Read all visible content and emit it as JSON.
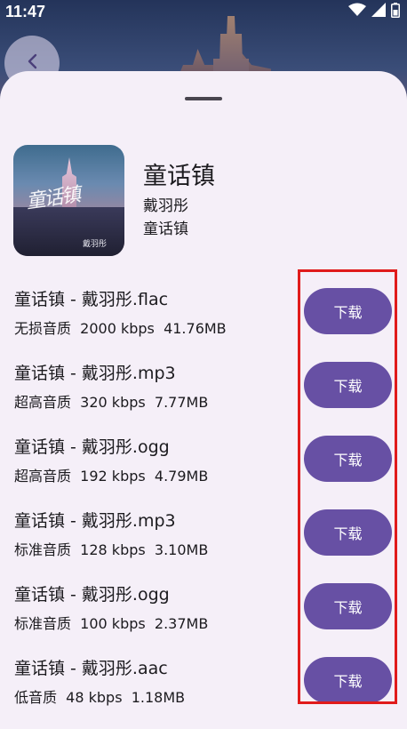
{
  "status_bar": {
    "time": "11:47"
  },
  "album": {
    "title": "童话镇",
    "artist": "戴羽彤",
    "album_name": "童话镇",
    "cover_title": "童话镇",
    "cover_sign": "戴羽彤"
  },
  "download_label": "下载",
  "files": [
    {
      "name": "童话镇 - 戴羽彤.flac",
      "info": "无损音质  2000 kbps  41.76MB"
    },
    {
      "name": "童话镇 - 戴羽彤.mp3",
      "info": "超高音质  320 kbps  7.77MB"
    },
    {
      "name": "童话镇 - 戴羽彤.ogg",
      "info": "超高音质  192 kbps  4.79MB"
    },
    {
      "name": "童话镇 - 戴羽彤.mp3",
      "info": "标准音质  128 kbps  3.10MB"
    },
    {
      "name": "童话镇 - 戴羽彤.ogg",
      "info": "标准音质  100 kbps  2.37MB"
    },
    {
      "name": "童话镇 - 戴羽彤.aac",
      "info": "低音质  48 kbps  1.18MB"
    }
  ],
  "colors": {
    "accent": "#6750a4",
    "sheet_background": "#f5eff8",
    "highlight_border": "#e01b1b"
  },
  "icons": [
    "back-arrow-icon",
    "wifi-icon",
    "cellular-signal-icon",
    "battery-icon"
  ]
}
